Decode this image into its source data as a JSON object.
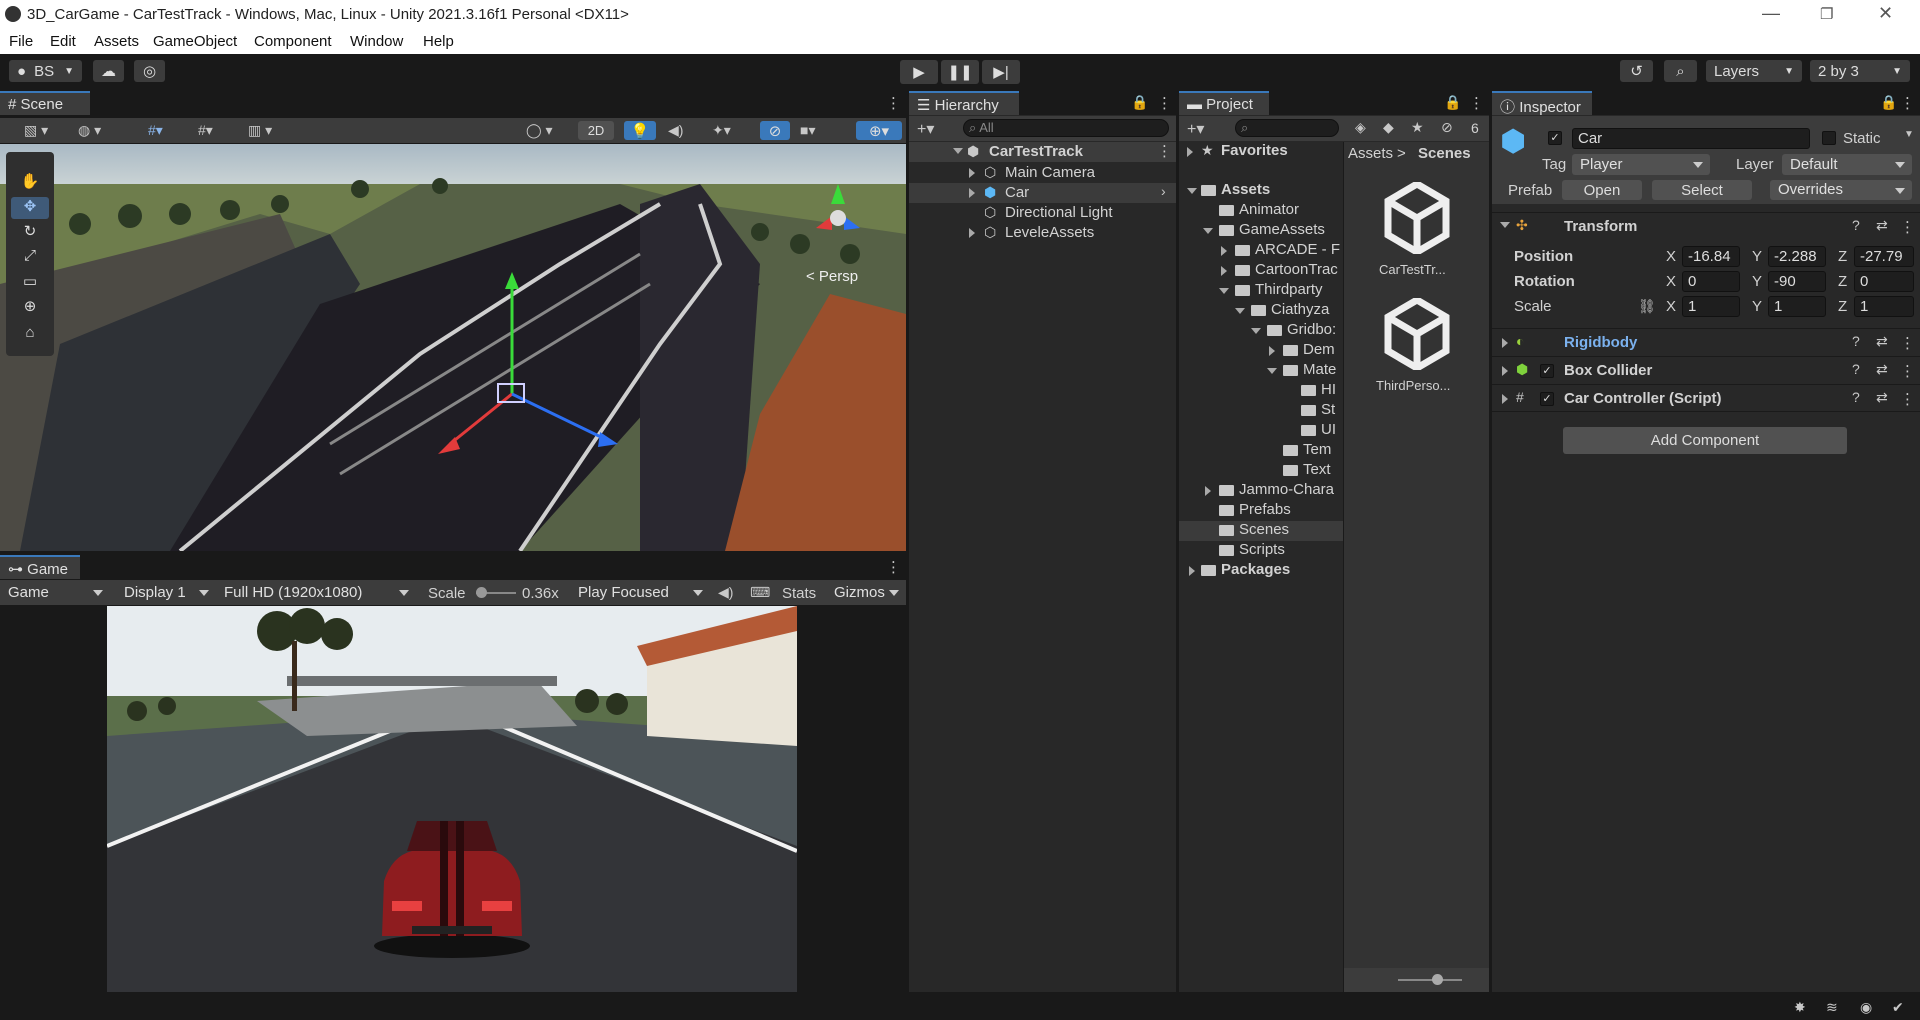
{
  "window": {
    "title": "3D_CarGame - CarTestTrack - Windows, Mac, Linux - Unity 2021.3.16f1 Personal <DX11>"
  },
  "menu": [
    "File",
    "Edit",
    "Assets",
    "GameObject",
    "Component",
    "Window",
    "Help"
  ],
  "toolbar": {
    "account": "BS",
    "layers": "Layers",
    "layout": "2 by 3"
  },
  "scene": {
    "tab": "Scene",
    "mode2d": "2D",
    "persp": "< Persp"
  },
  "game": {
    "tab": "Game",
    "view": "Game",
    "display": "Display 1",
    "resolution": "Full HD (1920x1080)",
    "scale_label": "Scale",
    "scale_value": "0.36x",
    "play_mode": "Play Focused",
    "stats": "Stats",
    "gizmos": "Gizmos"
  },
  "hierarchy": {
    "tab": "Hierarchy",
    "search_placeholder": "All",
    "scene_name": "CarTestTrack",
    "items": [
      "Main Camera",
      "Car",
      "Directional Light",
      "LeveleAssets"
    ]
  },
  "project": {
    "tab": "Project",
    "hidden_count": "6",
    "favorites": "Favorites",
    "assets": "Assets",
    "packages": "Packages",
    "tree": [
      "Animator",
      "GameAssets",
      "ARCADE - F",
      "CartoonTrac",
      "Thirdparty",
      "Ciathyza",
      "Gridbo:",
      "Dem",
      "Mate",
      "HI",
      "St",
      "UI",
      "Tem",
      "Text",
      "Jammo-Chara",
      "Prefabs",
      "Scenes",
      "Scripts"
    ],
    "breadcrumb_root": "Assets",
    "breadcrumb_sep": ">",
    "breadcrumb_current": "Scenes",
    "files": [
      "CarTestTr...",
      "ThirdPerso..."
    ]
  },
  "inspector": {
    "tab": "Inspector",
    "object_name": "Car",
    "static": "Static",
    "tag_label": "Tag",
    "tag_value": "Player",
    "layer_label": "Layer",
    "layer_value": "Default",
    "prefab_label": "Prefab",
    "open": "Open",
    "select": "Select",
    "overrides": "Overrides",
    "transform": {
      "title": "Transform",
      "position_label": "Position",
      "rotation_label": "Rotation",
      "scale_label": "Scale",
      "position": [
        "-16.84",
        "-2.288",
        "-27.79"
      ],
      "rotation": [
        "0",
        "-90",
        "0"
      ],
      "scale": [
        "1",
        "1",
        "1"
      ]
    },
    "axis": [
      "X",
      "Y",
      "Z"
    ],
    "components": [
      "Rigidbody",
      "Box Collider",
      "Car Controller (Script)"
    ],
    "add_component": "Add Component"
  },
  "colors": {
    "accent": "#3a79bb",
    "panel": "#282828",
    "field": "#1e1e1e",
    "rigidbody_link": "#7bb1ee"
  }
}
